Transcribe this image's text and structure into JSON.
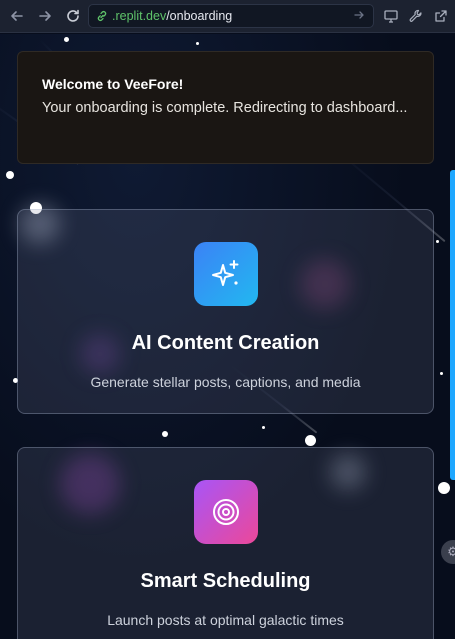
{
  "browser": {
    "url_host": ".replit.dev",
    "url_path": "/onboarding",
    "icons": [
      "back-icon",
      "forward-icon",
      "reload-icon",
      "link-icon",
      "go-icon",
      "monitor-icon",
      "wrench-icon",
      "open-external-icon"
    ]
  },
  "toast": {
    "title": "Welcome to VeeFore!",
    "message": "Your onboarding is complete. Redirecting to dashboard..."
  },
  "features": [
    {
      "icon": "sparkles-icon",
      "title": "AI Content Creation",
      "description": "Generate stellar posts, captions, and media",
      "accent": "#3b82f6"
    },
    {
      "icon": "target-icon",
      "title": "Smart Scheduling",
      "description": "Launch posts at optimal galactic times",
      "accent": "#c04ff0"
    }
  ],
  "colors": {
    "background": "#070d1c",
    "scroll_accent": "#1ea7ff",
    "url_host_color": "#5fc36a"
  }
}
